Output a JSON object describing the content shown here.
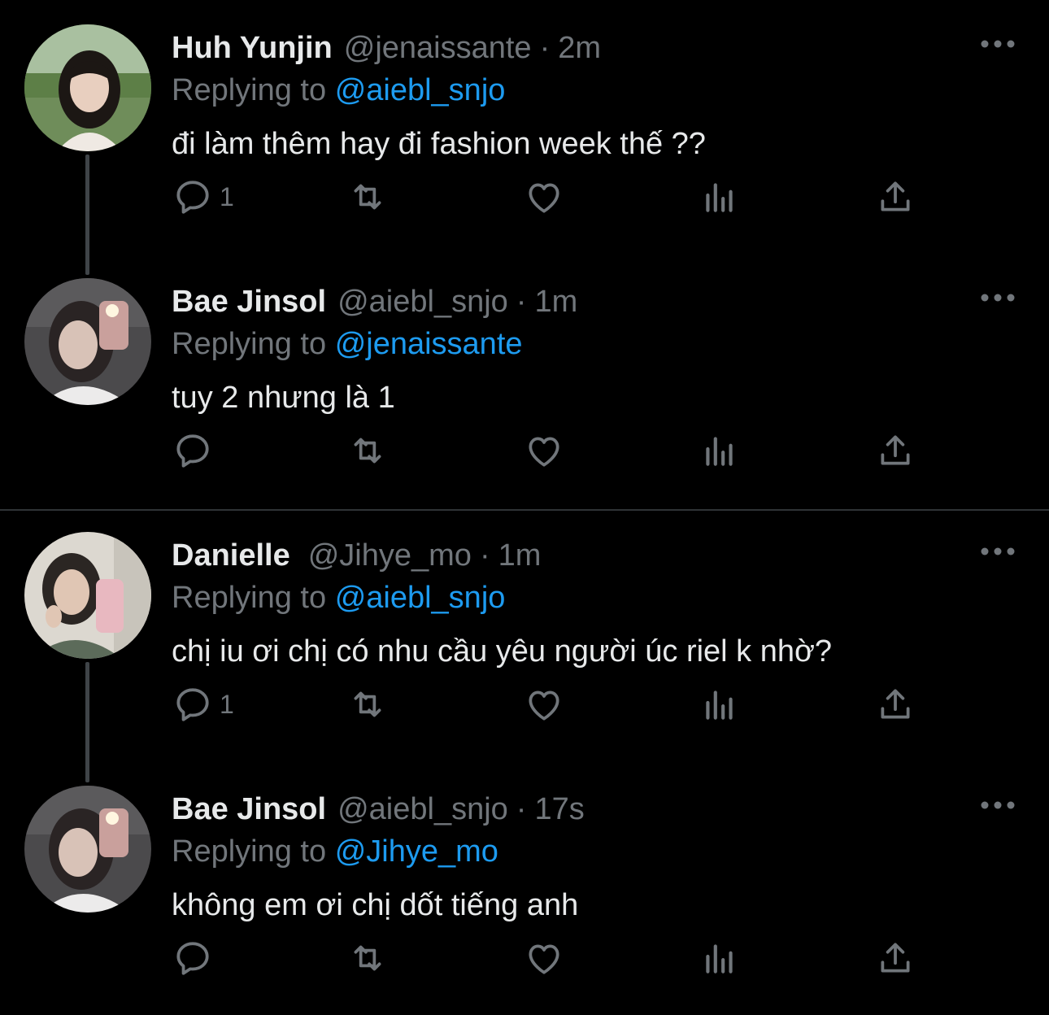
{
  "colors": {
    "background": "#000000",
    "text_primary": "#e7e9ea",
    "text_secondary": "#71767b",
    "accent": "#1d9bf0",
    "divider": "#2f3336"
  },
  "reply_prefix": "Replying to",
  "dot": "·",
  "tweets": [
    {
      "name": "Huh Yunjin",
      "handle": "@jenaissante",
      "time": "2m",
      "reply_to": "@aiebl_snjo",
      "text": "đi làm thêm hay đi fashion week thế ??",
      "reply_count": "1",
      "avatar_icon": "avatar-photo"
    },
    {
      "name": "Bae Jinsol",
      "handle": "@aiebl_snjo",
      "time": "1m",
      "reply_to": "@jenaissante",
      "text": "tuy 2 nhưng là 1",
      "reply_count": "",
      "avatar_icon": "avatar-photo"
    },
    {
      "name": "Danielle",
      "handle": "@Jihye_mo",
      "time": "1m",
      "reply_to": "@aiebl_snjo",
      "text": "chị iu ơi chị có nhu cầu yêu người úc riel k nhờ?",
      "reply_count": "1",
      "avatar_icon": "avatar-photo"
    },
    {
      "name": "Bae Jinsol",
      "handle": "@aiebl_snjo",
      "time": "17s",
      "reply_to": "@Jihye_mo",
      "text": "không em ơi chị dốt tiếng anh",
      "reply_count": "",
      "avatar_icon": "avatar-photo"
    }
  ],
  "icons": {
    "reply": "reply-icon",
    "retweet": "retweet-icon",
    "like": "like-icon",
    "views": "views-icon",
    "share": "share-icon",
    "more": "more-options-icon"
  }
}
